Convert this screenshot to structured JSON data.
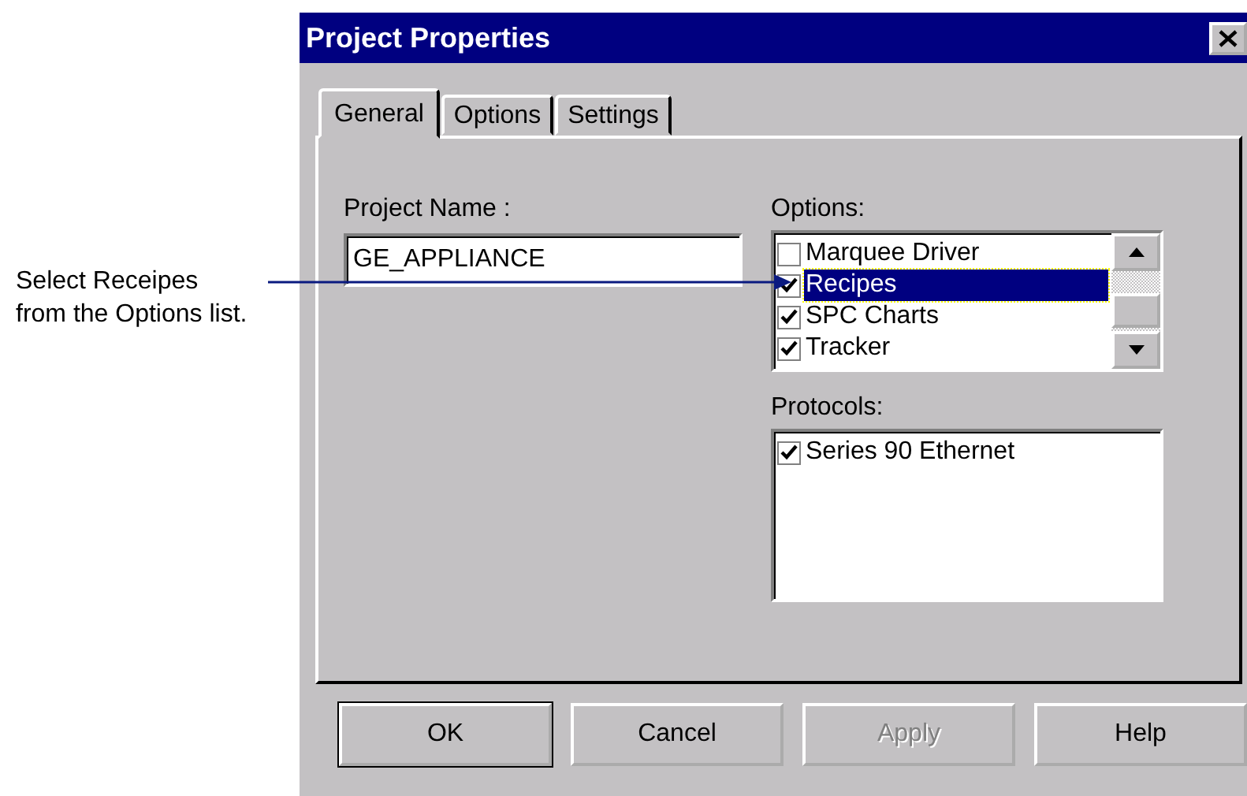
{
  "callout": {
    "text": "Select Receipes from the Options list."
  },
  "window": {
    "title": "Project Properties"
  },
  "tabs": [
    {
      "label": "General",
      "selected": true
    },
    {
      "label": "Options",
      "selected": false
    },
    {
      "label": "Settings",
      "selected": false
    }
  ],
  "project_name": {
    "label": "Project Name :",
    "value": "GE_APPLIANCE"
  },
  "options": {
    "label": "Options:",
    "items": [
      {
        "label": "Marquee Driver",
        "checked": false,
        "selected": false
      },
      {
        "label": "Recipes",
        "checked": true,
        "selected": true
      },
      {
        "label": "SPC Charts",
        "checked": true,
        "selected": false
      },
      {
        "label": "Tracker",
        "checked": true,
        "selected": false
      }
    ]
  },
  "protocols": {
    "label": "Protocols:",
    "items": [
      {
        "label": "Series 90 Ethernet",
        "checked": true,
        "selected": false
      }
    ]
  },
  "buttons": [
    {
      "label": "OK",
      "default": true,
      "disabled": false
    },
    {
      "label": "Cancel",
      "default": false,
      "disabled": false
    },
    {
      "label": "Apply",
      "default": false,
      "disabled": true
    },
    {
      "label": "Help",
      "default": false,
      "disabled": false
    }
  ]
}
